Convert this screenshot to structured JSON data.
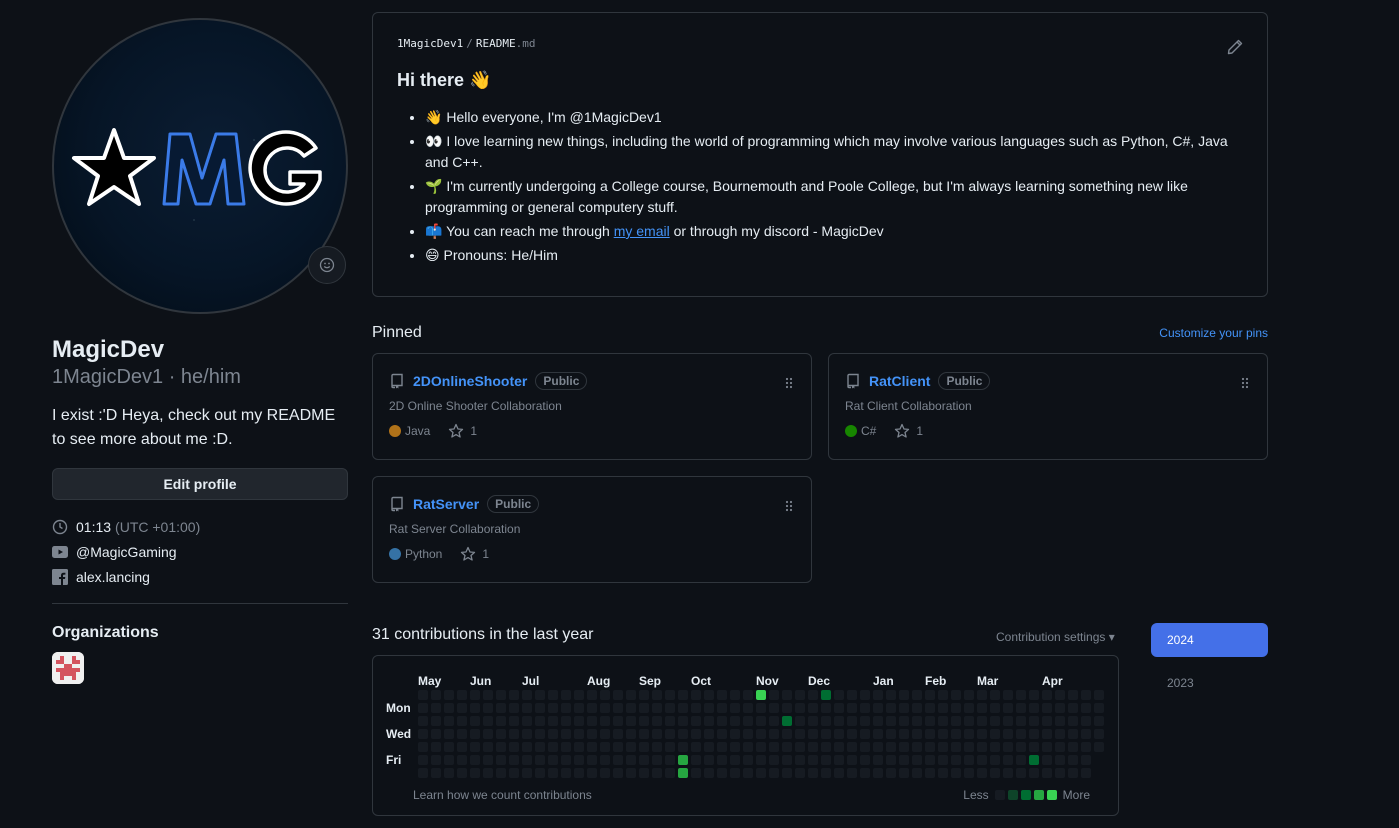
{
  "profile": {
    "name": "MagicDev",
    "login_line": "1MagicDev1 · he/him",
    "bio": "I exist :'D Heya, check out my README to see more about me :D.",
    "edit_label": "Edit profile",
    "time": "01:13",
    "timezone": "(UTC +01:00)",
    "youtube": "@MagicGaming",
    "facebook": "alex.lancing",
    "orgs_title": "Organizations"
  },
  "readme": {
    "user": "1MagicDev1",
    "sep": "/",
    "file": "README",
    "ext": ".md",
    "heading": "Hi there 👋",
    "items": [
      {
        "emoji": "👋",
        "text": "Hello everyone, I'm @1MagicDev1"
      },
      {
        "emoji": "👀",
        "text": "I love learning new things, including the world of programming which may involve various languages such as Python, C#, Java and C++."
      },
      {
        "emoji": "🌱",
        "text": "I'm currently undergoing a College course, Bournemouth and Poole College, but I'm always learning something new like programming or general computery stuff."
      },
      {
        "emoji": "📫",
        "pre": "You can reach me through ",
        "link": "my email",
        "post": " or through my discord - MagicDev"
      },
      {
        "emoji": "😄",
        "text": "Pronouns: He/Him"
      }
    ]
  },
  "pinned": {
    "title": "Pinned",
    "customize": "Customize your pins",
    "public_label": "Public",
    "repos": [
      {
        "name": "2DOnlineShooter",
        "desc": "2D Online Shooter Collaboration",
        "lang": "Java",
        "lang_color": "#b07219",
        "stars": "1"
      },
      {
        "name": "RatClient",
        "desc": "Rat Client Collaboration",
        "lang": "C#",
        "lang_color": "#178600",
        "stars": "1"
      },
      {
        "name": "RatServer",
        "desc": "Rat Server Collaboration",
        "lang": "Python",
        "lang_color": "#3572A5",
        "stars": "1"
      }
    ]
  },
  "contributions": {
    "title": "31 contributions in the last year",
    "settings": "Contribution settings ▾",
    "months": [
      "May",
      "Jun",
      "Jul",
      "Aug",
      "Sep",
      "Oct",
      "Nov",
      "Dec",
      "Jan",
      "Feb",
      "Mar",
      "Apr"
    ],
    "days": [
      "Mon",
      "Wed",
      "Fri"
    ],
    "learn": "Learn how we count contributions",
    "less": "Less",
    "more": "More",
    "levels": [
      "#161b22",
      "#0e4429",
      "#006d32",
      "#26a641",
      "#39d353"
    ],
    "active_cells": [
      {
        "week": 20,
        "day": 5,
        "level": 3
      },
      {
        "week": 20,
        "day": 6,
        "level": 3
      },
      {
        "week": 26,
        "day": 0,
        "level": 4
      },
      {
        "week": 28,
        "day": 2,
        "level": 2
      },
      {
        "week": 31,
        "day": 0,
        "level": 2
      },
      {
        "week": 47,
        "day": 5,
        "level": 2
      }
    ],
    "years": [
      "2024",
      "2023"
    ]
  }
}
